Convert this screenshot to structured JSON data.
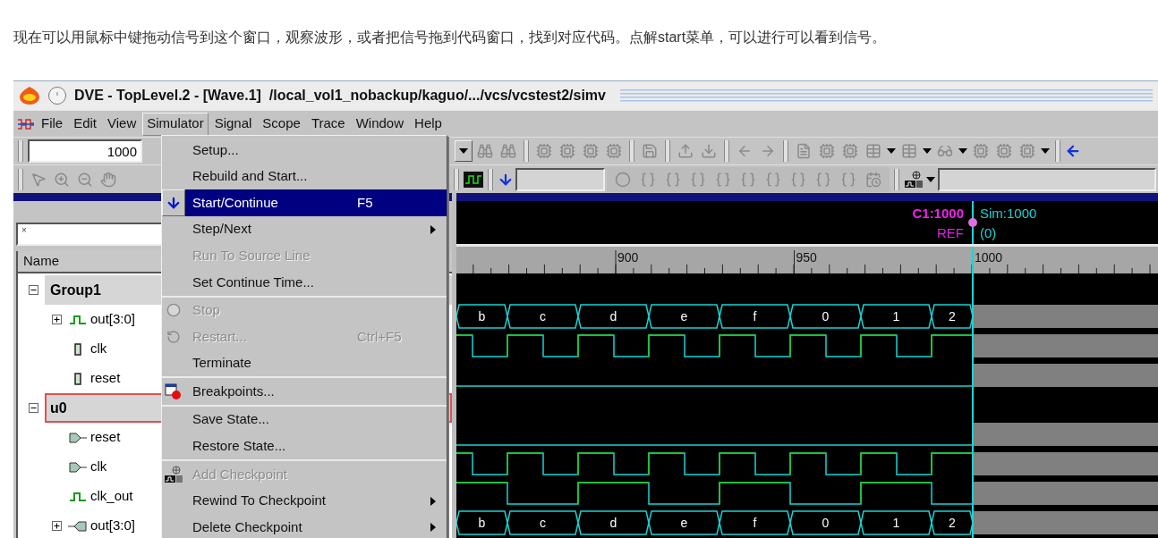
{
  "caption": "现在可以用鼠标中键拖动信号到这个窗口，观察波形，或者把信号拖到代码窗口，找到对应代码。点解start菜单，可以进行可以看到信号。",
  "window": {
    "title": "DVE - TopLevel.2 - [Wave.1]  /local_vol1_nobackup/kaguo/.../vcs/vcstest2/simv"
  },
  "menubar": [
    {
      "label": "File",
      "selected": false
    },
    {
      "label": "Edit",
      "selected": false
    },
    {
      "label": "View",
      "selected": false
    },
    {
      "label": "Simulator",
      "selected": true
    },
    {
      "label": "Signal",
      "selected": false
    },
    {
      "label": "Scope",
      "selected": false
    },
    {
      "label": "Trace",
      "selected": false
    },
    {
      "label": "Window",
      "selected": false
    },
    {
      "label": "Help",
      "selected": false
    }
  ],
  "toolbar": {
    "time_field": {
      "value": "1000"
    }
  },
  "simulator_menu": {
    "sections": [
      [
        {
          "label": "Setup...",
          "kind": "plain",
          "selected": false,
          "disabled": false,
          "submenu": false
        },
        {
          "label": "Rebuild and Start...",
          "kind": "plain",
          "selected": false,
          "disabled": false,
          "submenu": false
        },
        {
          "label": "Start/Continue",
          "kind": "run",
          "shortcut": "F5",
          "selected": true,
          "disabled": false,
          "submenu": false
        },
        {
          "label": "Step/Next",
          "kind": "plain",
          "selected": false,
          "disabled": false,
          "submenu": true
        },
        {
          "label": "Run To Source Line",
          "kind": "plain",
          "selected": false,
          "disabled": true,
          "submenu": false
        },
        {
          "label": "Set Continue Time...",
          "kind": "plain",
          "selected": false,
          "disabled": false,
          "submenu": false
        }
      ],
      [
        {
          "label": "Stop",
          "kind": "stop",
          "selected": false,
          "disabled": true,
          "submenu": false
        },
        {
          "label": "Restart...",
          "kind": "restart",
          "shortcut": "Ctrl+F5",
          "selected": false,
          "disabled": true,
          "submenu": false
        },
        {
          "label": "Terminate",
          "kind": "plain",
          "selected": false,
          "disabled": false,
          "submenu": false
        }
      ],
      [
        {
          "label": "Breakpoints...",
          "kind": "breakpoint",
          "selected": false,
          "disabled": false,
          "submenu": false
        }
      ],
      [
        {
          "label": "Save State...",
          "kind": "plain",
          "selected": false,
          "disabled": false,
          "submenu": false
        },
        {
          "label": "Restore State...",
          "kind": "plain",
          "selected": false,
          "disabled": false,
          "submenu": false
        }
      ],
      [
        {
          "label": "Add Checkpoint",
          "kind": "checkpoint",
          "selected": false,
          "disabled": true,
          "submenu": false
        },
        {
          "label": "Rewind To Checkpoint",
          "kind": "plain",
          "selected": false,
          "disabled": false,
          "submenu": true
        },
        {
          "label": "Delete Checkpoint",
          "kind": "plain",
          "selected": false,
          "disabled": false,
          "submenu": true
        }
      ]
    ]
  },
  "signal_panel": {
    "filter_field": {
      "value": "×"
    },
    "column": "Name",
    "tree": [
      {
        "label": "Group1",
        "kind": "group",
        "selected": false,
        "expanded": true,
        "children": [
          {
            "label": "out[3:0]",
            "kind": "wire",
            "expanded": false,
            "wave": {
              "kind": "bus",
              "values": [
                "b",
                "c",
                "d",
                "e",
                "f",
                "0",
                "1",
                "2"
              ]
            }
          },
          {
            "label": "clk",
            "kind": "reg",
            "wave": {
              "kind": "clock"
            }
          },
          {
            "label": "reset",
            "kind": "reg",
            "wave": {
              "kind": "low"
            }
          }
        ]
      },
      {
        "label": "u0",
        "kind": "group",
        "selected": true,
        "expanded": true,
        "children": [
          {
            "label": "reset",
            "kind": "input",
            "wave": {
              "kind": "low"
            }
          },
          {
            "label": "clk",
            "kind": "input",
            "wave": {
              "kind": "clock"
            }
          },
          {
            "label": "clk_out",
            "kind": "wire",
            "wave": {
              "kind": "clock_div2"
            }
          },
          {
            "label": "out[3:0]",
            "kind": "output",
            "expanded": false,
            "wave": {
              "kind": "bus",
              "values": [
                "b",
                "c",
                "d",
                "e",
                "f",
                "0",
                "1",
                "2"
              ]
            }
          }
        ]
      }
    ]
  },
  "wave_view": {
    "cursor": {
      "label": "C1:1000",
      "ref": "REF"
    },
    "sim": {
      "time": "Sim:1000",
      "delta": "(0)"
    },
    "ruler": [
      {
        "label": "900"
      },
      {
        "label": "950"
      },
      {
        "label": "1000"
      }
    ]
  }
}
